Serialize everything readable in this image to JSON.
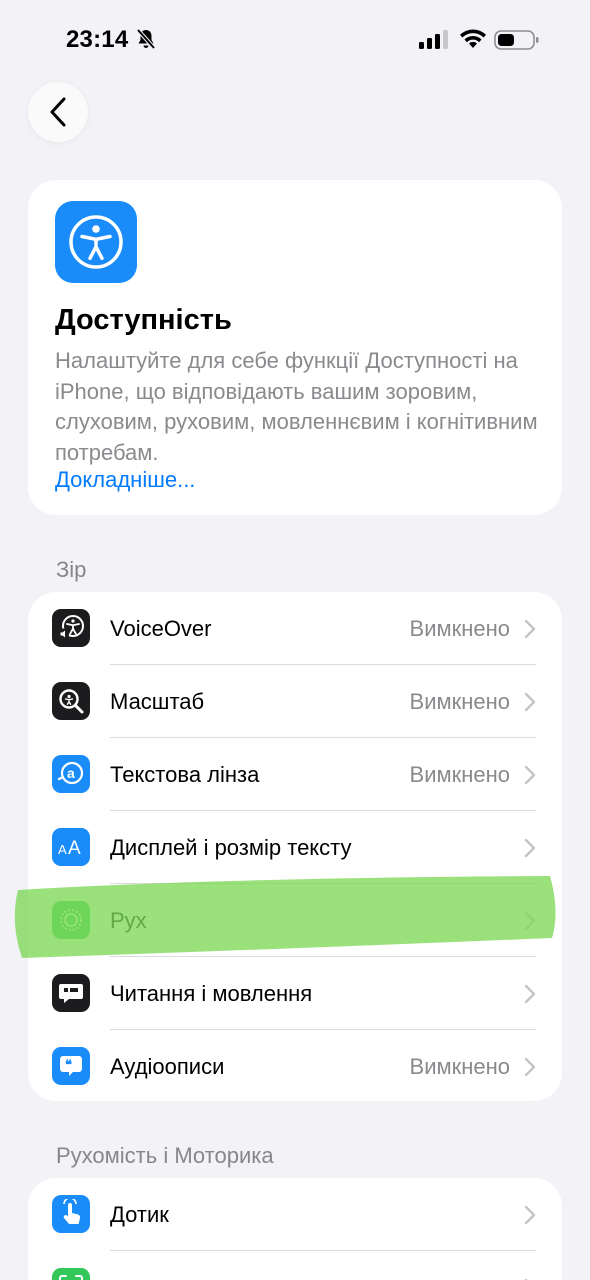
{
  "status_bar": {
    "time": "23:14"
  },
  "header": {
    "title": "Доступність",
    "description": "Налаштуйте для себе функції Доступності на iPhone, що відповідають вашим зоровим, слуховим, руховим, мовленнєвим і когнітивним потребам.",
    "link": "Докладніше..."
  },
  "vision": {
    "title": "Зір",
    "items": [
      {
        "label": "VoiceOver",
        "value": "Вимкнено",
        "icon": "voiceover-icon",
        "color": "#1c1c1e"
      },
      {
        "label": "Масштаб",
        "value": "Вимкнено",
        "icon": "zoom-icon",
        "color": "#1c1c1e"
      },
      {
        "label": "Текстова лінза",
        "value": "Вимкнено",
        "icon": "hover-text-icon",
        "color": "#1a8cfa"
      },
      {
        "label": "Дисплей і розмір тексту",
        "value": "",
        "icon": "text-size-icon",
        "color": "#1a8cfa"
      },
      {
        "label": "Рух",
        "value": "",
        "icon": "motion-icon",
        "color": "#34c759"
      },
      {
        "label": "Читання і мовлення",
        "value": "",
        "icon": "spoken-content-icon",
        "color": "#1c1c1e"
      },
      {
        "label": "Аудіоописи",
        "value": "Вимкнено",
        "icon": "audio-descriptions-icon",
        "color": "#1a8cfa"
      }
    ]
  },
  "motor": {
    "title": "Рухомість і Моторика",
    "items": [
      {
        "label": "Дотик",
        "value": "",
        "icon": "touch-icon",
        "color": "#1a8cfa"
      },
      {
        "label": "",
        "value": "",
        "icon": "face-id-icon",
        "color": "#34c759"
      }
    ]
  },
  "colors": {
    "accent": "#007aff",
    "highlight": "#7ed957"
  }
}
